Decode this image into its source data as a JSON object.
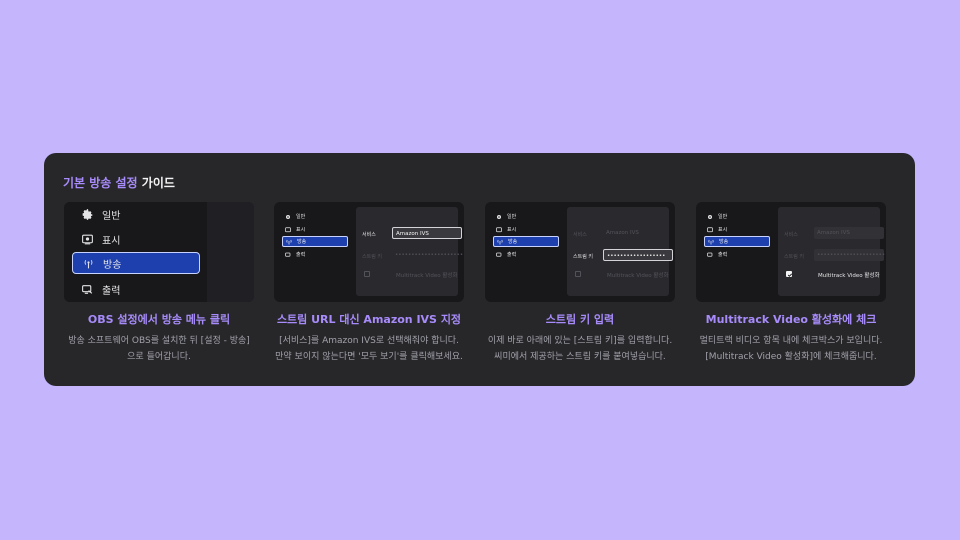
{
  "guide": {
    "title_accent": "기본 방송 설정",
    "title_rest": " 가이드"
  },
  "menu": {
    "general": "일반",
    "display": "표시",
    "broadcast": "방송",
    "output": "출력"
  },
  "form": {
    "service_label": "서비스",
    "service_value": "Amazon IVS",
    "stream_key_label": "스트림 키",
    "stream_key_mask": "••••••••••••••••••",
    "stream_key_mask_dim": "••••••••••••••••••••••",
    "multitrack_label": "Multitrack Video 활성화"
  },
  "steps": [
    {
      "title": "OBS 설정에서 방송 메뉴 클릭",
      "desc_line1": "방송 소프트웨어 OBS를 설치한 뒤 [설정 - 방송]",
      "desc_line2": "으로 들어갑니다."
    },
    {
      "title": "스트림 URL 대신  Amazon IVS 지정",
      "desc_line1": "[서비스]를 Amazon IVS로 선택해줘야 합니다.",
      "desc_line2": "만약 보이지 않는다면 '모두 보기'를 클릭해보세요."
    },
    {
      "title": "스트림 키 입력",
      "desc_line1": "이제 바로 아래에 있는 [스트림 키]를 입력합니다.",
      "desc_line2": "씨미에서 제공하는 스트림 키를 붙여넣습니다."
    },
    {
      "title": "Multitrack Video 활성화에 체크",
      "desc_line1": "멀티트랙 비디오 항목 내에 체크박스가 보입니다.",
      "desc_line2": "[Multitrack Video 활성화]에 체크해줍니다."
    }
  ],
  "colors": {
    "accent": "#a78bfa",
    "page_bg": "#c4b5fd",
    "card_bg": "#27272a",
    "active_menu": "#1e40af"
  }
}
